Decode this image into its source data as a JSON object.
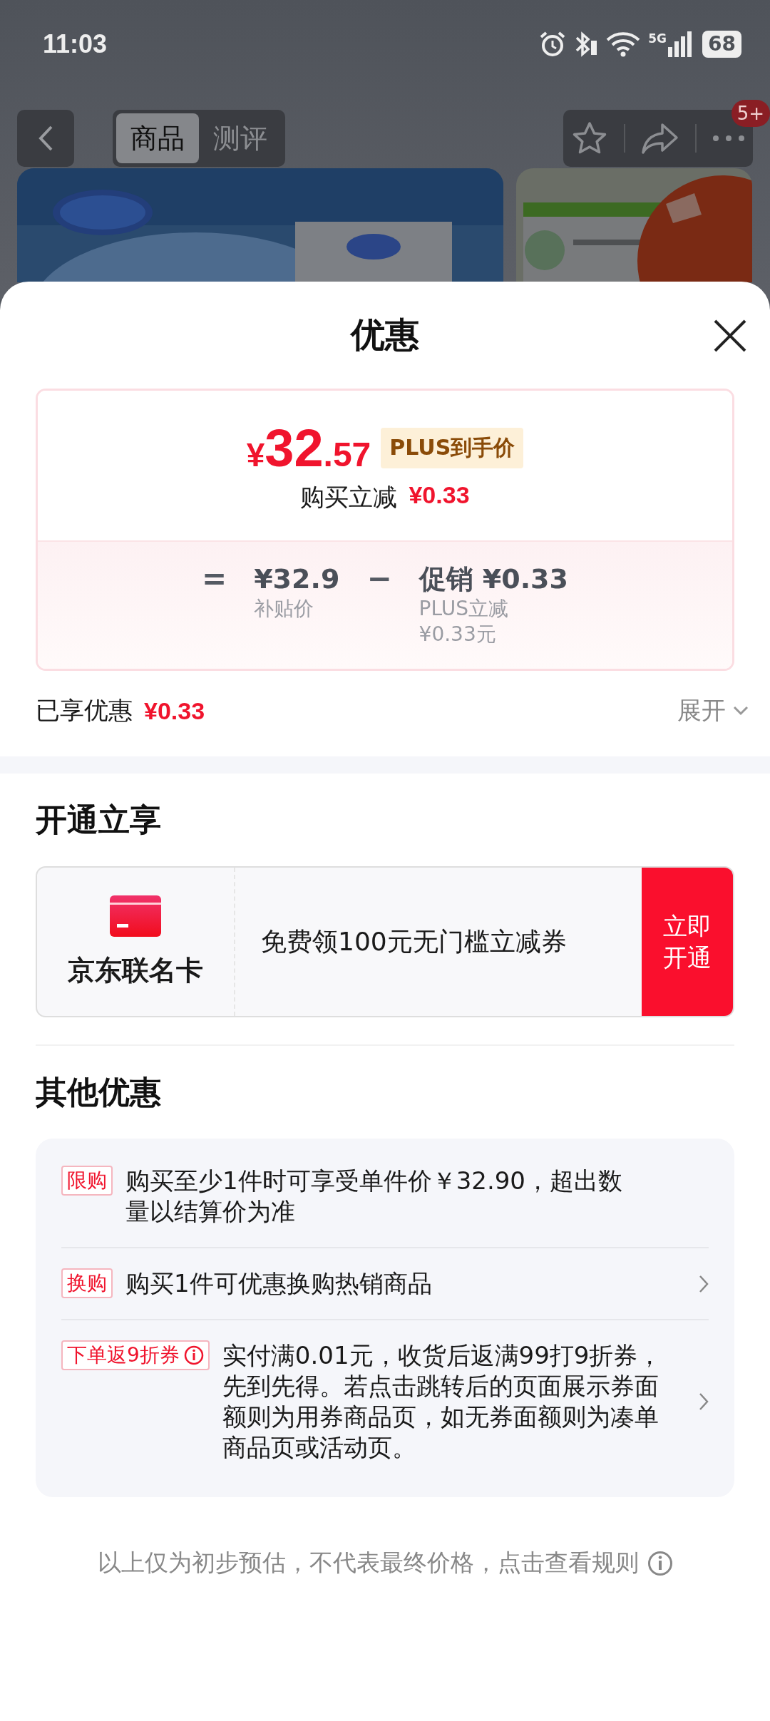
{
  "status_bar": {
    "time": "11:03",
    "network": "5G",
    "battery": "68"
  },
  "nav": {
    "tabs": [
      {
        "label": "商品",
        "selected": true
      },
      {
        "label": "测评",
        "selected": false
      }
    ],
    "badge": "5+"
  },
  "sheet": {
    "title": "优惠",
    "price": {
      "currency": "¥",
      "integer": "32",
      "decimal": ".57",
      "tag": "PLUS到手价"
    },
    "instant_cut": {
      "label": "购买立减",
      "amount": "¥0.33"
    },
    "breakdown": {
      "equals": "=",
      "base_value": "¥32.9",
      "base_label": "补贴价",
      "minus": "−",
      "promo_value": "促销 ¥0.33",
      "promo_notes": [
        "PLUS立减",
        "¥0.33元"
      ]
    },
    "enjoyed": {
      "label": "已享优惠",
      "amount": "¥0.33"
    },
    "expand": "展开"
  },
  "open_section": {
    "title": "开通立享",
    "card": {
      "name": "京东联名卡",
      "offer": "免费领100元无门槛立减券",
      "button": "立即开通"
    }
  },
  "other_section": {
    "title": "其他优惠",
    "items": [
      {
        "tag": "限购",
        "text": "购买至少1件时可享受单件价￥32.90，超出数量以结算价为准",
        "info": false,
        "arrow": false
      },
      {
        "tag": "换购",
        "text": "购买1件可优惠换购热销商品",
        "info": false,
        "arrow": true
      },
      {
        "tag": "下单返9折券",
        "text": "实付满0.01元，收货后返满99打9折券，先到先得。若点击跳转后的页面展示券面额则为用券商品页，如无券面额则为凑单商品页或活动页。",
        "info": true,
        "arrow": true
      }
    ]
  },
  "footer": "以上仅为初步预估，不代表最终价格，点击查看规则"
}
